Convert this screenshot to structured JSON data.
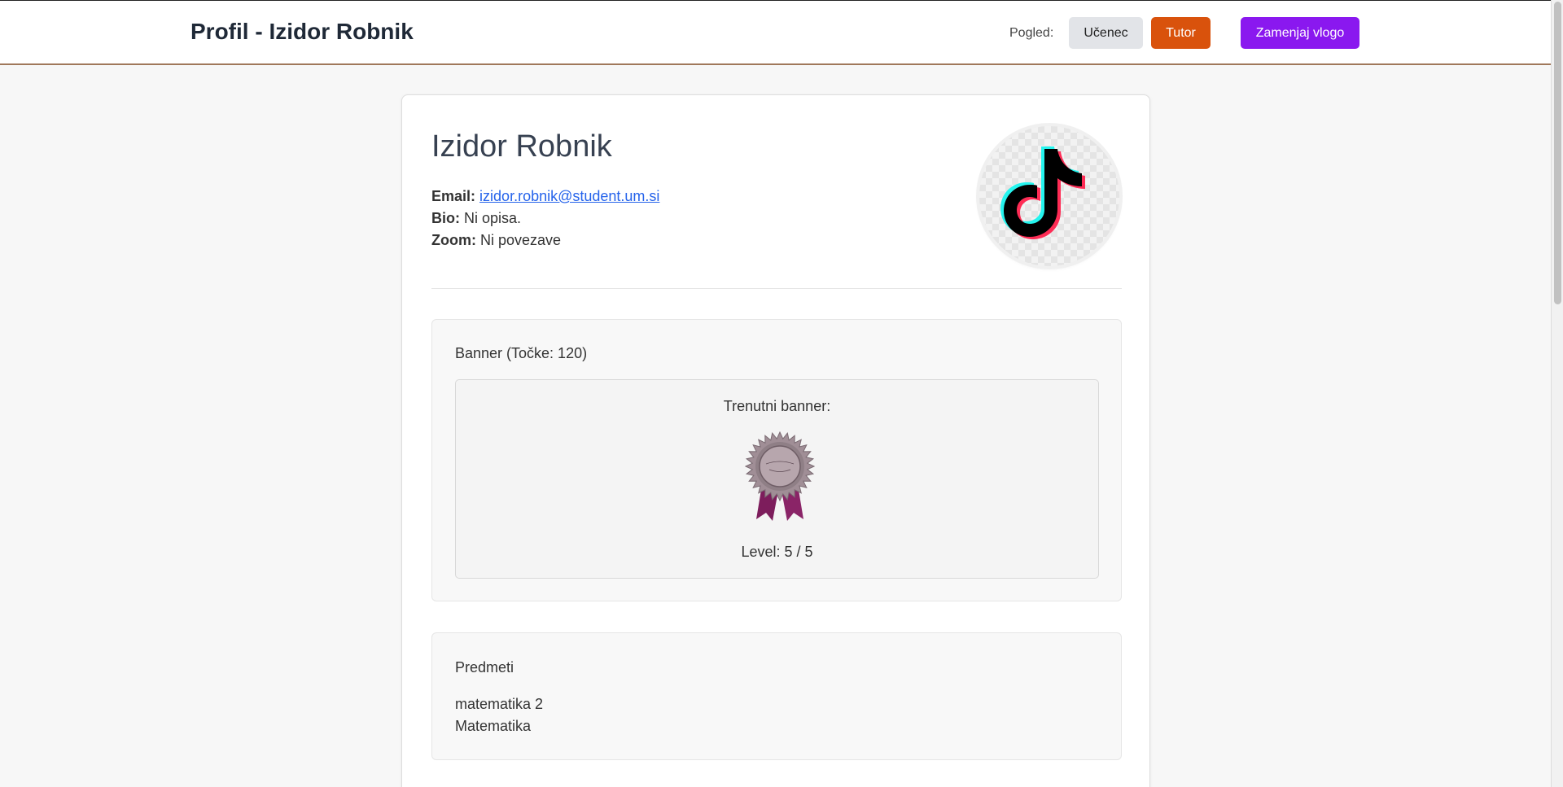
{
  "header": {
    "title": "Profil - Izidor Robnik",
    "view_label": "Pogled:",
    "student_button": "Učenec",
    "tutor_button": "Tutor",
    "switch_role_button": "Zamenjaj vlogo",
    "colors": {
      "tutor": "#d9520c",
      "switch": "#8a18ef",
      "border": "#a0785a"
    }
  },
  "profile": {
    "name": "Izidor Robnik",
    "email_label": "Email:",
    "email": "izidor.robnik@student.um.si",
    "bio_label": "Bio:",
    "bio": "Ni opisa.",
    "zoom_label": "Zoom:",
    "zoom": "Ni povezave",
    "avatar_icon": "tiktok-logo-icon"
  },
  "banner": {
    "title": "Banner (Točke: 120)",
    "current_label": "Trenutni banner:",
    "medal_icon": "award-rosette-icon",
    "level": "Level: 5 / 5"
  },
  "subjects": {
    "title": "Predmeti",
    "items": [
      "matematika 2",
      "Matematika"
    ]
  }
}
